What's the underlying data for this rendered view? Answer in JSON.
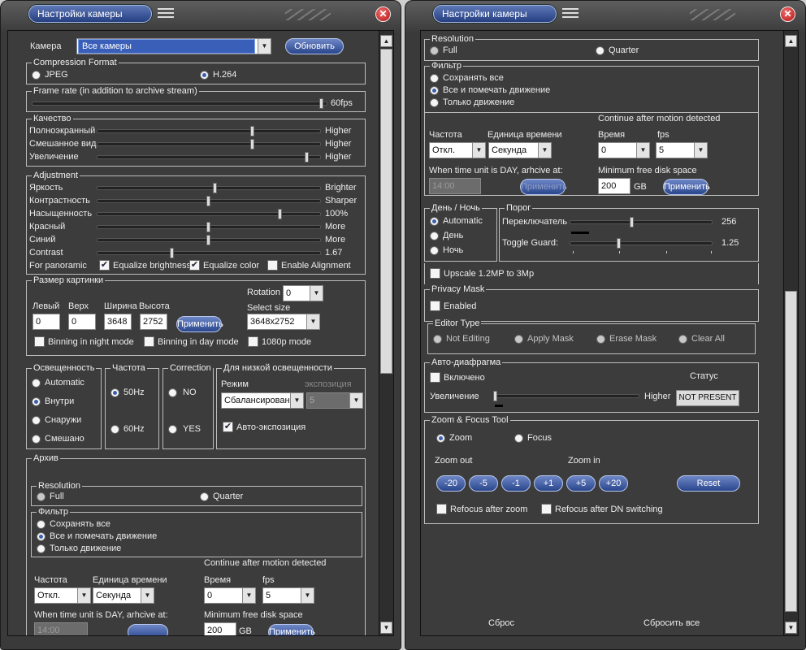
{
  "window": {
    "title": "Настройки камеры"
  },
  "left": {
    "camera_label": "Камера",
    "camera_value": "Все камеры",
    "refresh_btn": "Обновить",
    "compression": {
      "title": "Compression Format",
      "jpeg": "JPEG",
      "h264": "H.264",
      "selected": "H.264"
    },
    "framerate": {
      "title": "Frame rate (in addition to archive stream)",
      "value": "60fps"
    },
    "quality": {
      "title": "Качество",
      "rows": [
        {
          "label": "Полноэкранный",
          "value": "Higher"
        },
        {
          "label": "Смешанное вид",
          "value": "Higher"
        },
        {
          "label": "Увеличение",
          "value": "Higher"
        }
      ]
    },
    "adjustment": {
      "title": "Adjustment",
      "rows": [
        {
          "label": "Яркость",
          "value": "Brighter"
        },
        {
          "label": "Контрастность",
          "value": "Sharper"
        },
        {
          "label": "Насыщенность",
          "value": "100%"
        },
        {
          "label": "Красный",
          "value": "More"
        },
        {
          "label": "Синий",
          "value": "More"
        },
        {
          "label": "Contrast",
          "value": "1.67"
        }
      ],
      "panoramic_label": "For panoramic",
      "eq_brightness": "Equalize brightness",
      "eq_color": "Equalize color",
      "enable_alignment": "Enable Alignment"
    },
    "size": {
      "title": "Размер картинки",
      "rotation_label": "Rotation",
      "rotation_value": "0",
      "left_label": "Левый",
      "top_label": "Верх",
      "width_label": "Ширина",
      "height_label": "Высота",
      "left": "0",
      "top": "0",
      "width": "3648",
      "height": "2752",
      "apply": "Применить",
      "select_size_label": "Select size",
      "select_size": "3648x2752",
      "binning_night": "Binning in night mode",
      "binning_day": "Binning in day mode",
      "hd1080": "1080p mode"
    },
    "light": {
      "title": "Освещенность",
      "options": [
        "Automatic",
        "Внутри",
        "Снаружи",
        "Смешано"
      ],
      "selected": "Внутри"
    },
    "freq": {
      "title": "Частота",
      "options": [
        "50Hz",
        "60Hz"
      ],
      "selected": "50Hz"
    },
    "correction": {
      "title": "Correction",
      "options": [
        "NO",
        "YES"
      ]
    },
    "lowlight": {
      "title": "Для низкой освещенности",
      "mode_label": "Режим",
      "exposure_label": "экспозиция",
      "mode_value": "Сбалансирован",
      "exposure_value": "5",
      "auto_exposure": "Авто-экспозиция"
    },
    "archive": {
      "title": "Архив",
      "resolution_title": "Resolution",
      "full": "Full",
      "quarter": "Quarter",
      "filter_title": "Фильтр",
      "filters": [
        "Сохранять все",
        "Все и помечать движение",
        "Только движение"
      ],
      "filter_selected": "Все и помечать движение",
      "continue_label": "Continue after motion detected",
      "freq_label": "Частота",
      "unit_label": "Единица времени",
      "time_label": "Время",
      "fps_label": "fps",
      "freq_value": "Откл.",
      "unit_value": "Секунда",
      "time_value": "0",
      "fps_value": "5",
      "day_label": "When time unit is DAY, arhcive at:",
      "day_value": "14:00",
      "disk_label": "Minimum free disk space",
      "disk_value": "200",
      "disk_unit": "GB",
      "apply": "Применить"
    }
  },
  "right": {
    "archive": {
      "resolution_title": "Resolution",
      "full": "Full",
      "quarter": "Quarter",
      "filter_title": "Фильтр",
      "filters": [
        "Сохранять все",
        "Все и помечать движение",
        "Только движение"
      ],
      "filter_selected": "Все и помечать движение",
      "continue_label": "Continue after motion detected",
      "freq_label": "Частота",
      "unit_label": "Единица времени",
      "time_label": "Время",
      "fps_label": "fps",
      "freq_value": "Откл.",
      "unit_value": "Секунда",
      "time_value": "0",
      "fps_value": "5",
      "day_label": "When time unit is DAY, arhcive at:",
      "day_value": "14:00",
      "day_apply": "Применить",
      "disk_label": "Minimum free disk space",
      "disk_value": "200",
      "disk_unit": "GB",
      "apply": "Применить"
    },
    "daynight": {
      "title": "День / Ночь",
      "options": [
        "Automatic",
        "День",
        "Ночь"
      ],
      "selected": "Automatic"
    },
    "threshold": {
      "title": "Порог",
      "switch_label": "Переключатель",
      "switch_value": "256",
      "guard_label": "Toggle Guard:",
      "guard_value": "1.25"
    },
    "upscale": "Upscale 1.2MP to 3Mp",
    "privacy": {
      "title": "Privacy Mask",
      "enabled": "Enabled",
      "editor_title": "Editor Type",
      "options": [
        "Not Editing",
        "Apply Mask",
        "Erase Mask",
        "Clear All"
      ]
    },
    "iris": {
      "title": "Авто-диафрагма",
      "enabled": "Включено",
      "status_label": "Статус",
      "zoom_label": "Увеличение",
      "higher": "Higher",
      "status_value": "NOT PRESENT"
    },
    "zoom": {
      "title": "Zoom & Focus Tool",
      "zoom_opt": "Zoom",
      "focus_opt": "Focus",
      "zoom_out": "Zoom out",
      "zoom_in": "Zoom in",
      "buttons": [
        "-20",
        "-5",
        "-1",
        "+1",
        "+5",
        "+20"
      ],
      "reset": "Reset",
      "refocus_zoom": "Refocus after zoom",
      "refocus_dn": "Refocus after DN switching"
    },
    "footer": {
      "reset": "Сброс",
      "reset_all": "Сбросить все"
    }
  }
}
